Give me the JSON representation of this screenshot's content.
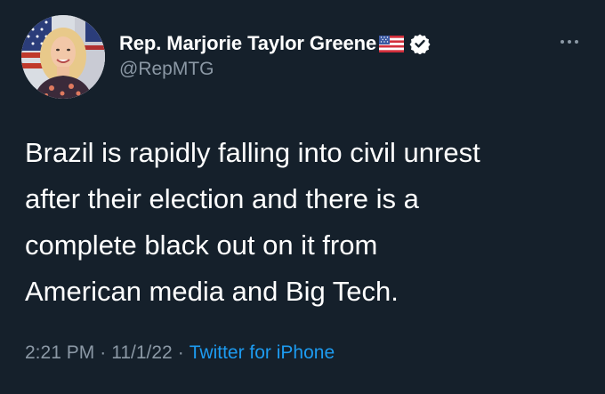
{
  "tweet": {
    "author": {
      "display_name": "Rep. Marjorie Taylor Greene",
      "handle": "@RepMTG",
      "name_emoji_icon": "us-flag-icon",
      "verified_icon": "verified-badge-icon"
    },
    "text": "Brazil is rapidly falling into civil unrest\nafter their election and there is a\ncomplete black out on it from\nAmerican media and Big Tech.",
    "time": "2:21 PM",
    "date": "11/1/22",
    "separator": "·",
    "source": "Twitter for iPhone",
    "more_icon": "more-dots-icon"
  },
  "colors": {
    "background": "#15202b",
    "text_primary": "#ffffff",
    "text_secondary": "#8b98a5",
    "accent": "#1d9bf0"
  }
}
